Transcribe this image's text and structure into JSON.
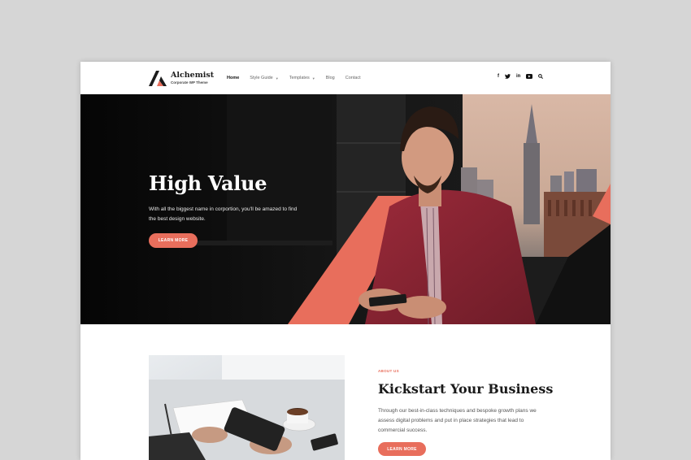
{
  "header": {
    "brand_name": "Alchemist",
    "brand_tagline": "Corporate WP Theme",
    "nav": [
      {
        "label": "Home",
        "active": true,
        "dropdown": false
      },
      {
        "label": "Style Guide",
        "active": false,
        "dropdown": true
      },
      {
        "label": "Templates",
        "active": false,
        "dropdown": true
      },
      {
        "label": "Blog",
        "active": false,
        "dropdown": false
      },
      {
        "label": "Contact",
        "active": false,
        "dropdown": false
      }
    ],
    "social_icons": [
      "facebook-icon",
      "twitter-icon",
      "linkedin-icon",
      "youtube-icon",
      "search-icon"
    ],
    "social_glyphs": {
      "facebook": "f",
      "twitter": "t",
      "linkedin": "in"
    }
  },
  "hero": {
    "title": "High Value",
    "text": "With all the biggest name in corportion, you'll be amazed to find the best design website.",
    "button_label": "LEARN MORE"
  },
  "about": {
    "label": "ABOUT US",
    "title": "Kickstart Your Business",
    "text": "Through our best-in-class techniques and bespoke growth plans we assess digital problems and put in place strategies that lead to commercial success.",
    "button_label": "LEARN MORE"
  },
  "colors": {
    "accent": "#e86e5c",
    "dark": "#0b0b0b",
    "page_background": "#d6d6d6"
  }
}
